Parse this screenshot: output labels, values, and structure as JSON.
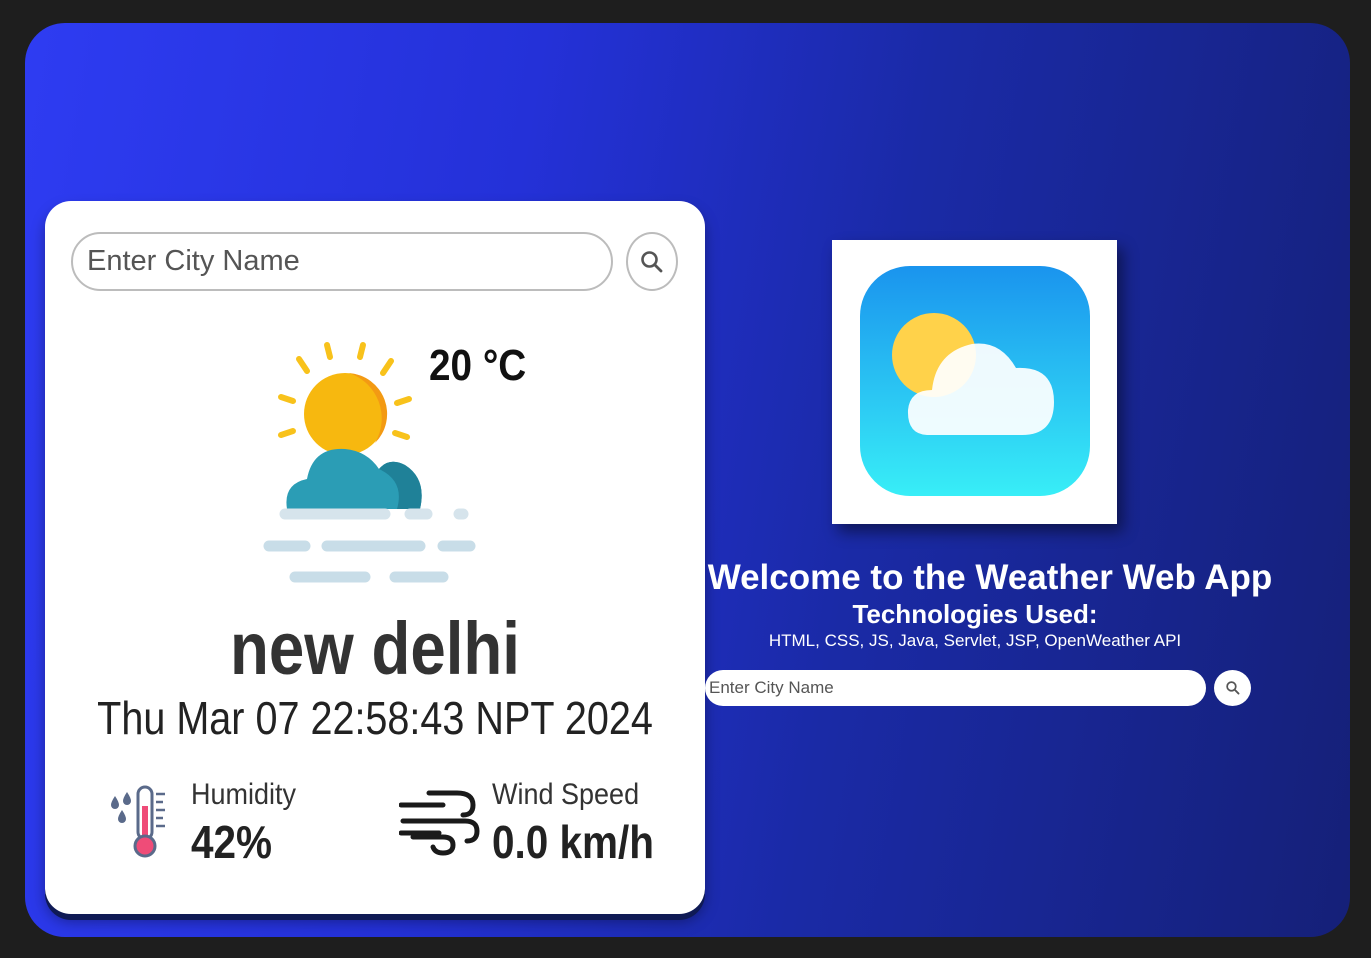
{
  "search": {
    "placeholder": "Enter City Name",
    "button_icon": "search-icon"
  },
  "weather": {
    "condition_icon": "sun-cloud-fog-icon",
    "temperature": "20 °C",
    "city": "new delhi",
    "datetime": "Thu Mar 07 22:58:43 NPT 2024",
    "humidity_label": "Humidity",
    "humidity_value": "42%",
    "humidity_icon": "humidity-thermometer-icon",
    "wind_label": "Wind Speed",
    "wind_value": "0.0 km/h",
    "wind_icon": "wind-icon"
  },
  "welcome": {
    "logo_icon": "weather-app-logo-icon",
    "title": "Welcome to the Weather Web App",
    "tech_title": "Technologies Used:",
    "tech_list": "HTML, CSS, JS, Java, Servlet, JSP, OpenWeather API",
    "search_placeholder": "Enter City Name"
  },
  "colors": {
    "background_start": "#2e3cf2",
    "background_end": "#152078",
    "card": "#ffffff"
  }
}
